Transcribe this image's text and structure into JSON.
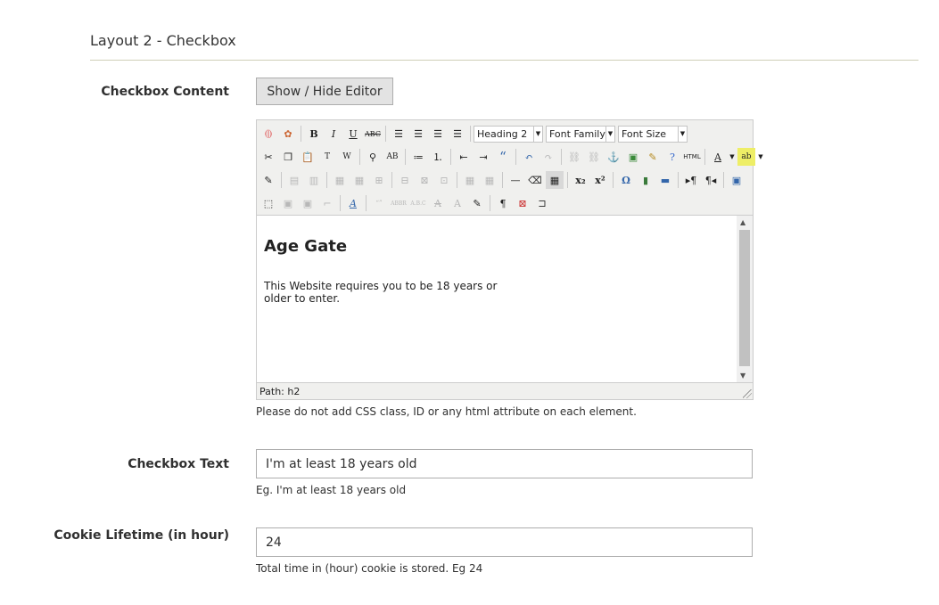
{
  "section": {
    "title": "Layout 2 - Checkbox"
  },
  "checkbox_content": {
    "label": "Checkbox Content",
    "toggle_button": "Show / Hide Editor",
    "editor": {
      "format_select": "Heading 2",
      "font_family_select": "Font Family",
      "font_size_select": "Font Size",
      "heading": "Age Gate",
      "paragraph": "This Website requires you to be 18 years or older to enter.",
      "path": "Path: h2"
    },
    "note": "Please do not add CSS class, ID or any html attribute on each element."
  },
  "checkbox_text": {
    "label": "Checkbox Text",
    "value": "I'm at least 18 years old",
    "note": "Eg. I'm at least 18 years old"
  },
  "cookie_lifetime": {
    "label": "Cookie Lifetime (in hour)",
    "value": "24",
    "note": "Total time in (hour) cookie is stored. Eg 24"
  },
  "toolbar_icons": {
    "row1": [
      "widget-icon",
      "image-icon",
      "bold-icon",
      "italic-icon",
      "underline-icon",
      "strikethrough-icon",
      "align-left-icon",
      "align-center-icon",
      "align-right-icon",
      "align-justify-icon"
    ],
    "row2": [
      "cut-icon",
      "copy-icon",
      "paste-icon",
      "paste-text-icon",
      "paste-word-icon",
      "find-icon",
      "replace-icon",
      "bullet-list-icon",
      "numbered-list-icon",
      "outdent-icon",
      "indent-icon",
      "blockquote-icon",
      "undo-icon",
      "redo-icon",
      "link-icon",
      "unlink-icon",
      "anchor-icon",
      "insert-image-icon",
      "cleanup-icon",
      "help-icon",
      "html-icon",
      "text-color-icon",
      "background-color-icon"
    ],
    "row3": [
      "edit-style-icon",
      "insert-layer-icon",
      "absolute-icon",
      "table-row-props-icon",
      "table-cell-props-icon",
      "insert-row-icon",
      "delete-row-icon",
      "split-cells-icon",
      "merge-cells-icon",
      "hr-icon",
      "remove-format-icon",
      "visual-aid-icon",
      "subscript-icon",
      "superscript-icon",
      "special-char-icon",
      "media-icon",
      "advanced-hr-icon",
      "ltr-icon",
      "rtl-icon",
      "fullscreen-icon"
    ],
    "row4": [
      "move-forward-icon",
      "move-backward-icon",
      "citation-icon",
      "acronym-icon",
      "abbreviation-icon",
      "deletion-icon",
      "insertion-icon",
      "attributes-icon",
      "show-blocks-icon",
      "nonbreaking-icon",
      "pagebreak-icon"
    ]
  }
}
